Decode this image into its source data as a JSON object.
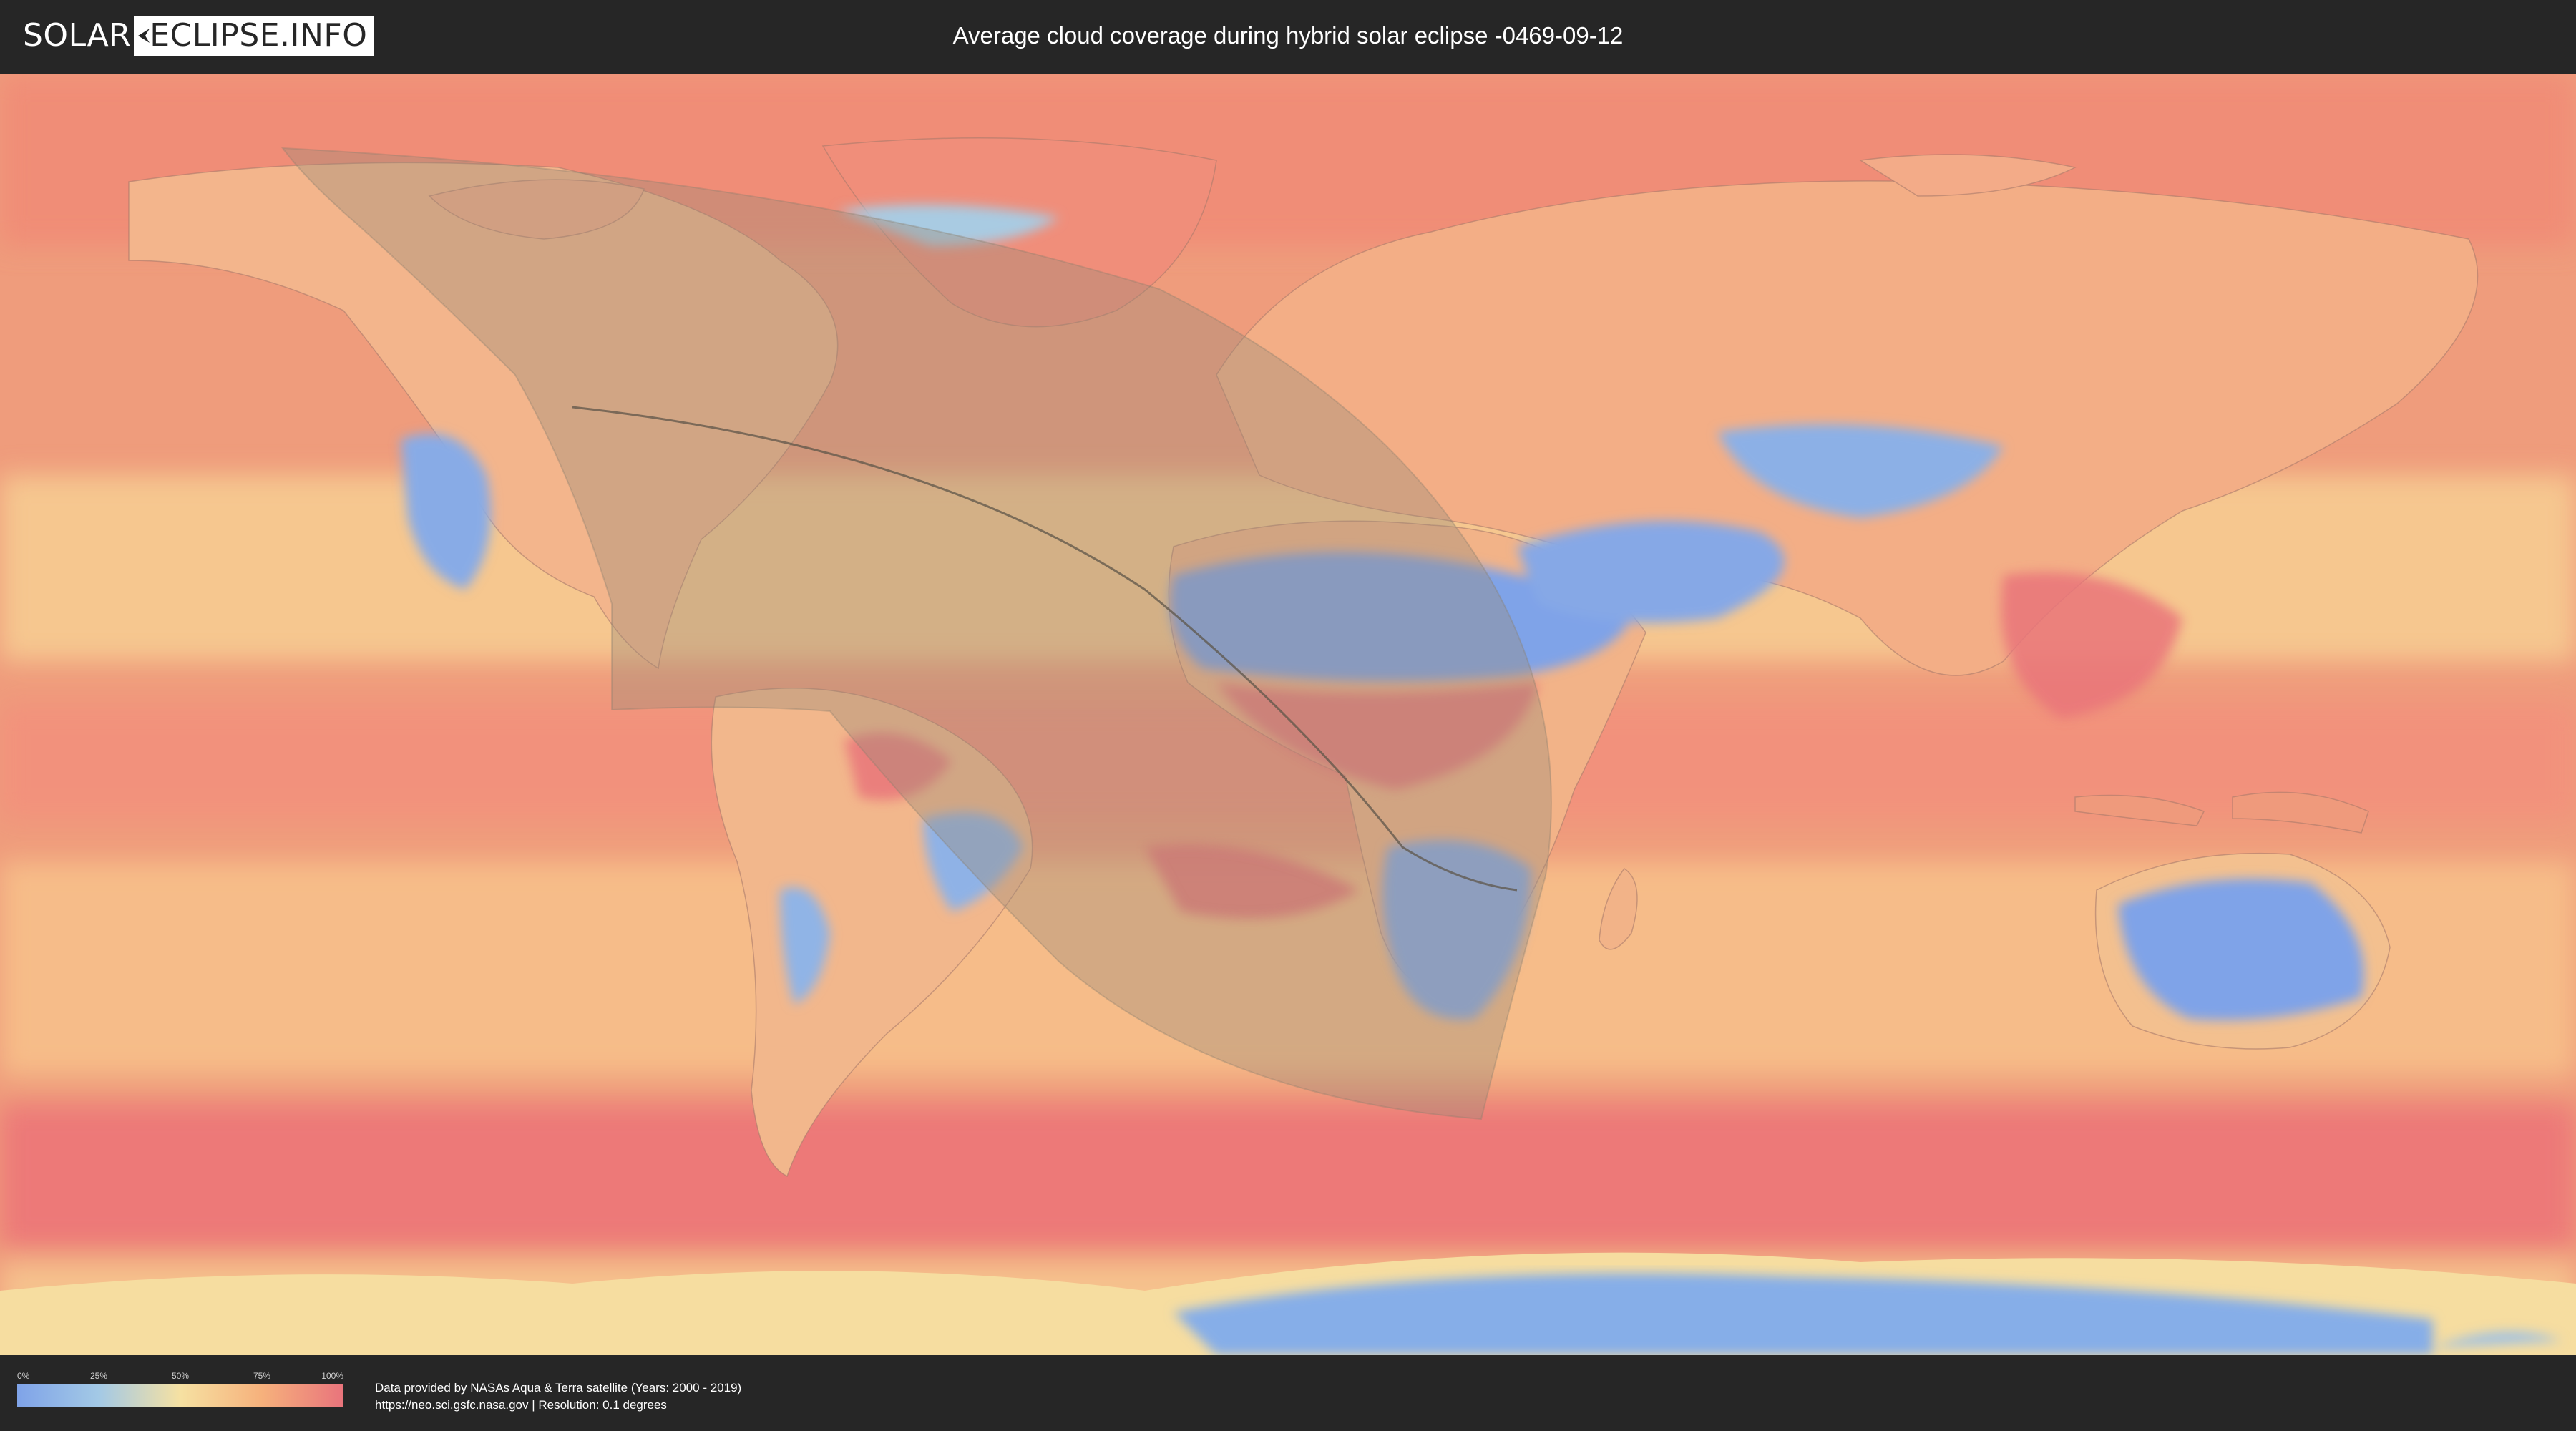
{
  "logo": {
    "part1": "SOLAR",
    "part2": "ECLIPSE.INFO"
  },
  "title": "Average cloud coverage during hybrid solar eclipse -0469-09-12",
  "legend": {
    "ticks": [
      "0%",
      "25%",
      "50%",
      "75%",
      "100%"
    ],
    "colors": [
      "#7fa3e8",
      "#a3c9e6",
      "#f6e1a2",
      "#f6b17c",
      "#e9747c"
    ]
  },
  "credits": {
    "line1": "Data provided by NASAs Aqua & Terra satellite (Years: 2000 - 2019)",
    "line2": "https://neo.sci.gsfc.nasa.gov | Resolution: 0.1 degrees"
  },
  "map": {
    "projection": "equirectangular",
    "ocean_base_color": "#ee9a7a",
    "low_cloud_color": "#7fa3e8",
    "eclipse_overlay_color": "#a08f78"
  }
}
